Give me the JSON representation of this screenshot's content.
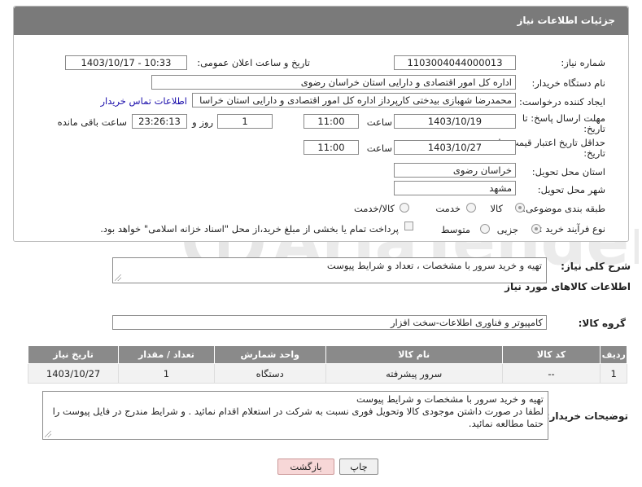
{
  "panel": {
    "title": "جزئیات اطلاعات نیاز"
  },
  "fields": {
    "need_number_label": "شماره نیاز:",
    "need_number": "1103004044000013",
    "announce_label": "تاریخ و ساعت اعلان عمومی:",
    "announce_value": "1403/10/17 - 10:33",
    "buyer_label": "نام دستگاه خریدار:",
    "buyer_value": "اداره کل امور اقتصادی و دارایی استان خراسان رضوی",
    "creator_label": "ایجاد کننده درخواست:",
    "creator_value": "محمدرضا شهبازی بیدختی کارپرداز اداره کل امور اقتصادی و دارایی استان خراسا",
    "buyer_contact_link": "اطلاعات تماس خریدار",
    "deadline_label_1": "مهلت ارسال پاسخ: تا",
    "deadline_label_2": "تاریخ:",
    "deadline_date": "1403/10/19",
    "time_word": "ساعت",
    "deadline_time": "11:00",
    "days_value": "1",
    "day_and": "روز و",
    "remaining_time": "23:26:13",
    "remaining_suffix": "ساعت باقی مانده",
    "validity_label_1": "حداقل تاریخ اعتبار قیمت: تا",
    "validity_label_2": "تاریخ:",
    "validity_date": "1403/10/27",
    "validity_time": "11:00",
    "province_label": "استان محل تحویل:",
    "province_value": "خراسان رضوی",
    "city_label": "شهر محل تحویل:",
    "city_value": "مشهد",
    "category_label": "طبقه بندی موضوعی:",
    "category_options": [
      "کالا",
      "خدمت",
      "کالا/خدمت"
    ],
    "category_selected": "کالا",
    "process_label": "نوع فرآیند خرید :",
    "process_options": [
      "جزیی",
      "متوسط"
    ],
    "process_selected": "جزیی",
    "payment_note": "پرداخت تمام یا بخشی از مبلغ خرید،از محل \"اسناد خزانه اسلامی\" خواهد بود."
  },
  "summary": {
    "label": "شرح کلی نیاز:",
    "value": "تهیه و خرید سرور با مشخصات ، تعداد و شرایط پیوست"
  },
  "goods_section": {
    "title": "اطلاعات کالاهای مورد نیاز",
    "group_label": "گروه کالا:",
    "group_value": "کامپیوتر و فناوری اطلاعات-سخت افزار"
  },
  "table": {
    "headers": [
      "ردیف",
      "کد کالا",
      "نام کالا",
      "واحد شمارش",
      "تعداد / مقدار",
      "تاریخ نیاز"
    ],
    "rows": [
      [
        "1",
        "--",
        "سرور پیشرفته",
        "دستگاه",
        "1",
        "1403/10/27"
      ]
    ]
  },
  "buyer_notes": {
    "label": "توضیحات خریدار:",
    "lines": [
      "تهیه و خرید سرور با مشخصات و شرایط پیوست",
      "لطفا در صورت داشتن موجودی کالا وتحویل فوری نسبت به شرکت در استعلام اقدام نمائید . و شرایط مندرج در فایل پیوست را",
      "حتما مطالعه نمائید."
    ]
  },
  "buttons": {
    "print": "چاپ",
    "back": "بازگشت"
  },
  "watermark": {
    "text": "AriaTender.neT"
  },
  "colors": {
    "header": "#7a7a7a",
    "link": "#1a0dab",
    "back_button_bg": "#f7d7d7"
  }
}
